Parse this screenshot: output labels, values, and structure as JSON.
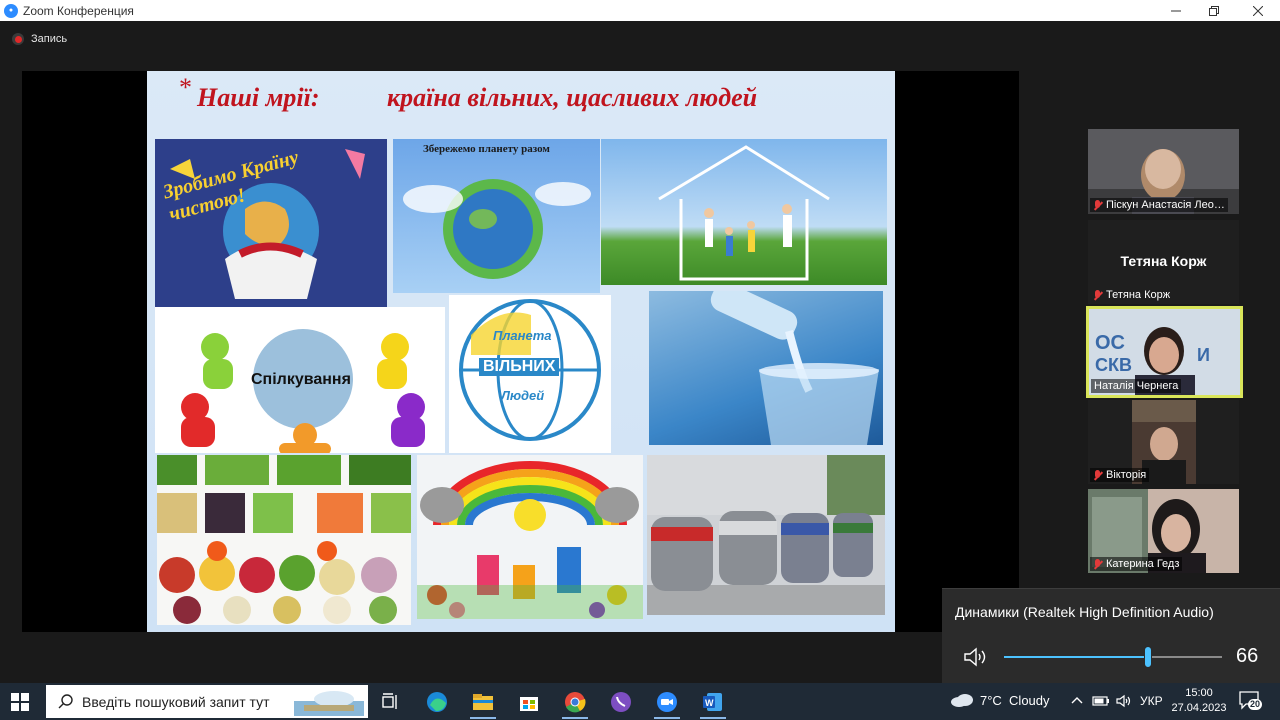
{
  "window": {
    "title": "Zoom Конференция",
    "recording_label": "Запись"
  },
  "slide": {
    "title_part1": "Наші мрії:",
    "title_part2": "країна вільних, щасливих людей",
    "star": "*",
    "tiles": {
      "clean_country_text": "Зробимо Країну чистою!",
      "save_planet_text": "Збережемо планету разом",
      "communication_text": "Спілкування",
      "planet_line1": "Планета",
      "planet_line2": "ВІЛЬНИХ",
      "planet_line3": "Людей"
    }
  },
  "participants": [
    {
      "name": "Піскун Анастасія Лео…",
      "muted": true
    },
    {
      "name": "Тетяна Корж",
      "display_name": "Тетяна Корж",
      "muted": true,
      "video": false
    },
    {
      "name": "Наталія Чернега",
      "muted": false,
      "active_speaker": true
    },
    {
      "name": "Вікторія",
      "muted": true
    },
    {
      "name": "Катерина Гедз",
      "muted": true
    }
  ],
  "volume_popup": {
    "device": "Динамики (Realtek High Definition Audio)",
    "level": 66,
    "level_fraction": 0.66
  },
  "taskbar": {
    "search_placeholder": "Введіть пошуковий запит тут",
    "weather": "7°C  Cloudy",
    "language": "УКР",
    "time": "15:00",
    "date": "27.04.2023",
    "notifications": "20",
    "apps": [
      "task-view",
      "edge",
      "file-explorer",
      "store",
      "chrome",
      "viber",
      "zoom",
      "word"
    ]
  },
  "colors": {
    "accent": "#4cc2ff",
    "title_red": "#c0141e",
    "active_border": "#d9e55a",
    "zoom_blue": "#2d8cff"
  }
}
